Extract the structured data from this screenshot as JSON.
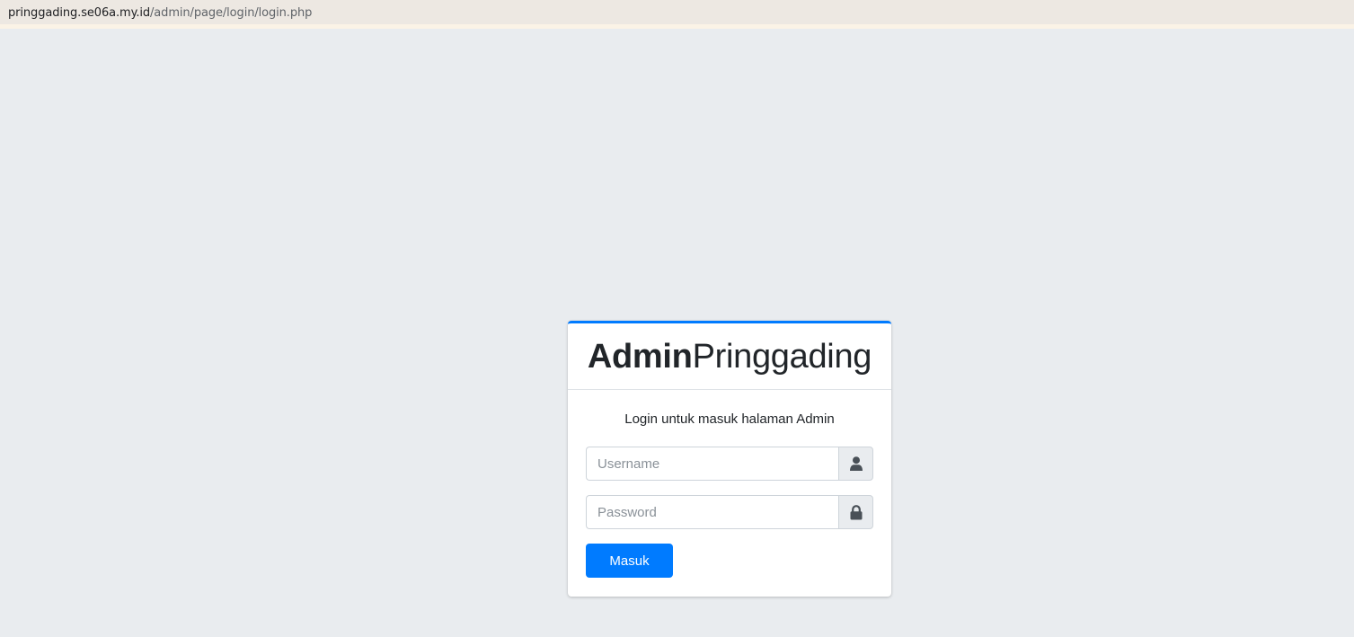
{
  "browser": {
    "url_host": "pringgading.se06a.my.id",
    "url_path": "/admin/page/login/login.php"
  },
  "login": {
    "brand_bold": "Admin",
    "brand_light": "Pringgading",
    "message": "Login untuk masuk halaman Admin",
    "username_placeholder": "Username",
    "username_value": "",
    "username_icon": "user-icon",
    "password_placeholder": "Password",
    "password_value": "",
    "password_icon": "lock-icon",
    "submit_label": "Masuk"
  },
  "colors": {
    "page_background": "#e9ecef",
    "accent": "#007bff",
    "card_background": "#ffffff"
  }
}
